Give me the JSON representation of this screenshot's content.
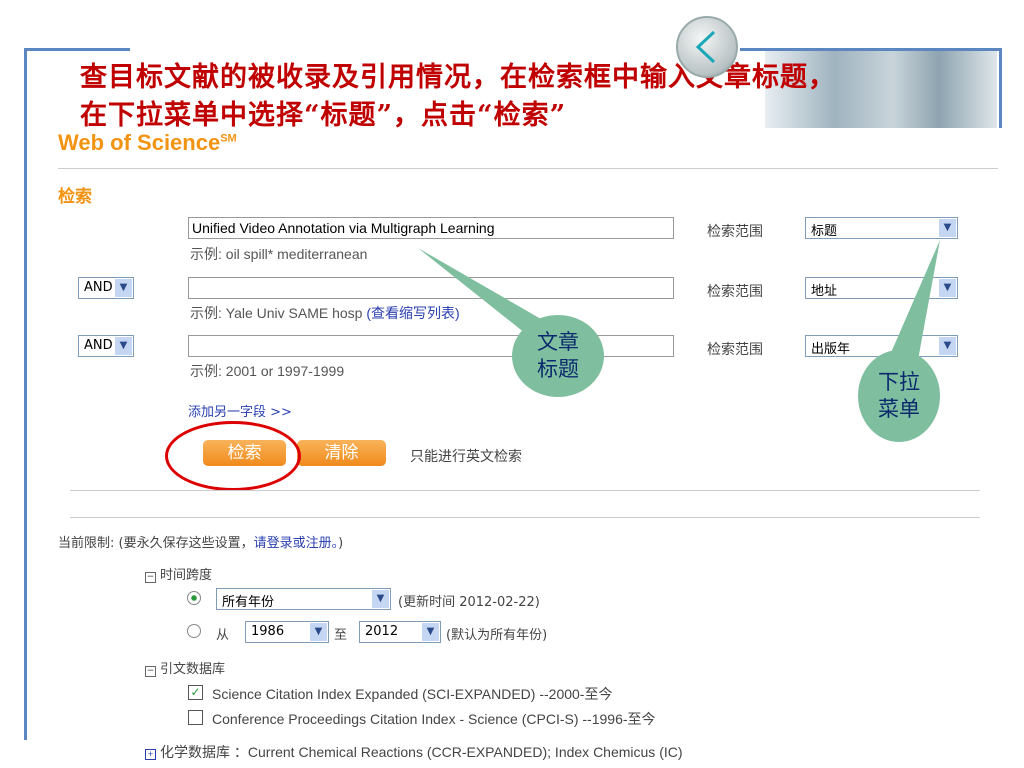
{
  "slide": {
    "title_line1": "查目标文献的被收录及引用情况，在检索框中输入文章标题，",
    "title_line2": "在下拉菜单中选择“标题”，点击“检索”",
    "callout_title": "文章\n标题",
    "callout_title_l1": "文章",
    "callout_title_l2": "标题",
    "callout_dropdown_l1": "下拉",
    "callout_dropdown_l2": "菜单"
  },
  "app": {
    "logo": "Web of Science",
    "logo_sup": "SM",
    "section": "检索"
  },
  "search": {
    "rows": [
      {
        "operator": "",
        "value": "Unified Video Annotation via Multigraph Learning",
        "example": "示例: oil spill* mediterranean",
        "scope_label": "检索范围",
        "scope": "标题"
      },
      {
        "operator": "AND",
        "value": "",
        "example": "示例: Yale Univ SAME hosp ",
        "example_link": "(查看缩写列表)",
        "scope_label": "检索范围",
        "scope": "地址"
      },
      {
        "operator": "AND",
        "value": "",
        "example": "示例: 2001 or 1997-1999",
        "scope_label": "检索范围",
        "scope": "出版年"
      }
    ],
    "add_field": "添加另一字段  >>",
    "search_button": "检索",
    "clear_button": "清除",
    "note": "只能进行英文检索"
  },
  "limits": {
    "label": "当前限制: (要永久保存这些设置，",
    "login_link": "请登录或注册。",
    "close": ")",
    "timespan": {
      "header": "时间跨度",
      "all_years": "所有年份",
      "updated": "(更新时间  2012-02-22)",
      "from_label": "从",
      "from": "1986",
      "to_label": "至",
      "to": "2012",
      "default_note": "(默认为所有年份)"
    },
    "citation_db": {
      "header": "引文数据库",
      "items": [
        {
          "label": "Science Citation Index Expanded (SCI-EXPANDED) --2000-至今",
          "checked": true
        },
        {
          "label": "Conference Proceedings Citation Index - Science (CPCI-S) --1996-至今",
          "checked": false
        }
      ]
    },
    "chem_db": {
      "header": "化学数据库 ：",
      "value": "Current Chemical Reactions (CCR-EXPANDED); Index Chemicus (IC)"
    }
  }
}
